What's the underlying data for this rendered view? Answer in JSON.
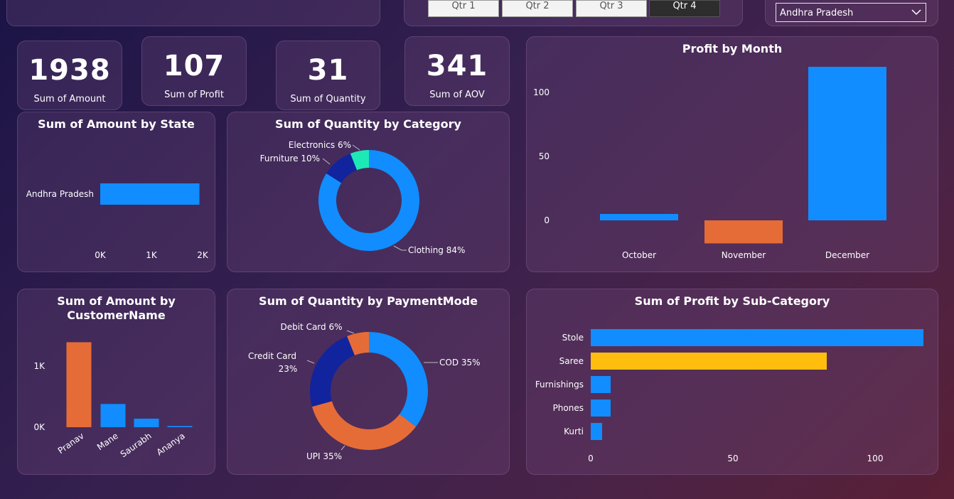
{
  "slicers": {
    "quarters": [
      "Qtr 1",
      "Qtr 2",
      "Qtr 3",
      "Qtr 4"
    ],
    "selected_quarter": "Qtr 4",
    "state_selected": "Andhra Pradesh"
  },
  "kpis": [
    {
      "value": "1938",
      "label": "Sum of Amount"
    },
    {
      "value": "107",
      "label": "Sum of Profit"
    },
    {
      "value": "31",
      "label": "Sum of Quantity"
    },
    {
      "value": "341",
      "label": "Sum of AOV"
    }
  ],
  "colors": {
    "blue": "#118dff",
    "orange": "#e66c37",
    "navy": "#12239e",
    "teal": "#1de9b6",
    "yellow": "#ffbe0e"
  },
  "chart_data": [
    {
      "id": "amount_by_state",
      "type": "bar",
      "orientation": "horizontal",
      "title": "Sum of Amount by State",
      "categories": [
        "Andhra Pradesh"
      ],
      "values": [
        1938
      ],
      "xticks": [
        "0K",
        "1K",
        "2K"
      ],
      "xlim": [
        0,
        2000
      ]
    },
    {
      "id": "qty_by_category",
      "type": "pie",
      "donut": true,
      "title": "Sum of Quantity by Category",
      "labels": [
        "Clothing",
        "Furniture",
        "Electronics"
      ],
      "values": [
        84,
        10,
        6
      ],
      "display": [
        "Clothing 84%",
        "Furniture 10%",
        "Electronics 6%"
      ],
      "colors": [
        "#118dff",
        "#12239e",
        "#1de9b6"
      ]
    },
    {
      "id": "profit_by_month",
      "type": "bar",
      "title": "Profit by Month",
      "categories": [
        "October",
        "November",
        "December"
      ],
      "values": [
        5,
        -18,
        120
      ],
      "colors": [
        "#118dff",
        "#e66c37",
        "#118dff"
      ],
      "yticks": [
        "100",
        "50",
        "0"
      ],
      "ylim": [
        -20,
        125
      ]
    },
    {
      "id": "amount_by_customer",
      "type": "bar",
      "title": "Sum of Amount by CustomerName",
      "categories": [
        "Pranav",
        "Mane",
        "Saurabh",
        "Ananya"
      ],
      "values": [
        1390,
        380,
        140,
        20
      ],
      "colors": [
        "#e66c37",
        "#118dff",
        "#118dff",
        "#118dff"
      ],
      "yticks": [
        "1K",
        "0K"
      ],
      "ylim": [
        0,
        1500
      ]
    },
    {
      "id": "qty_by_paymentmode",
      "type": "pie",
      "donut": true,
      "title": "Sum of Quantity by PaymentMode",
      "labels": [
        "COD",
        "UPI",
        "Credit Card",
        "Debit Card"
      ],
      "values": [
        35,
        35,
        23,
        6
      ],
      "display": [
        "COD 35%",
        "UPI 35%",
        "Credit Card",
        "23%",
        "Debit Card 6%"
      ],
      "colors": [
        "#118dff",
        "#e66c37",
        "#12239e",
        "#e66c37"
      ]
    },
    {
      "id": "profit_by_subcategory",
      "type": "bar",
      "orientation": "horizontal",
      "title": "Sum of Profit by Sub-Category",
      "categories": [
        "Stole",
        "Saree",
        "Furnishings",
        "Phones",
        "Kurti"
      ],
      "values": [
        117,
        83,
        7,
        7,
        4
      ],
      "colors": [
        "#118dff",
        "#ffbe0e",
        "#118dff",
        "#118dff",
        "#118dff"
      ],
      "xticks": [
        "0",
        "50",
        "100"
      ],
      "xlim": [
        0,
        125
      ]
    }
  ]
}
